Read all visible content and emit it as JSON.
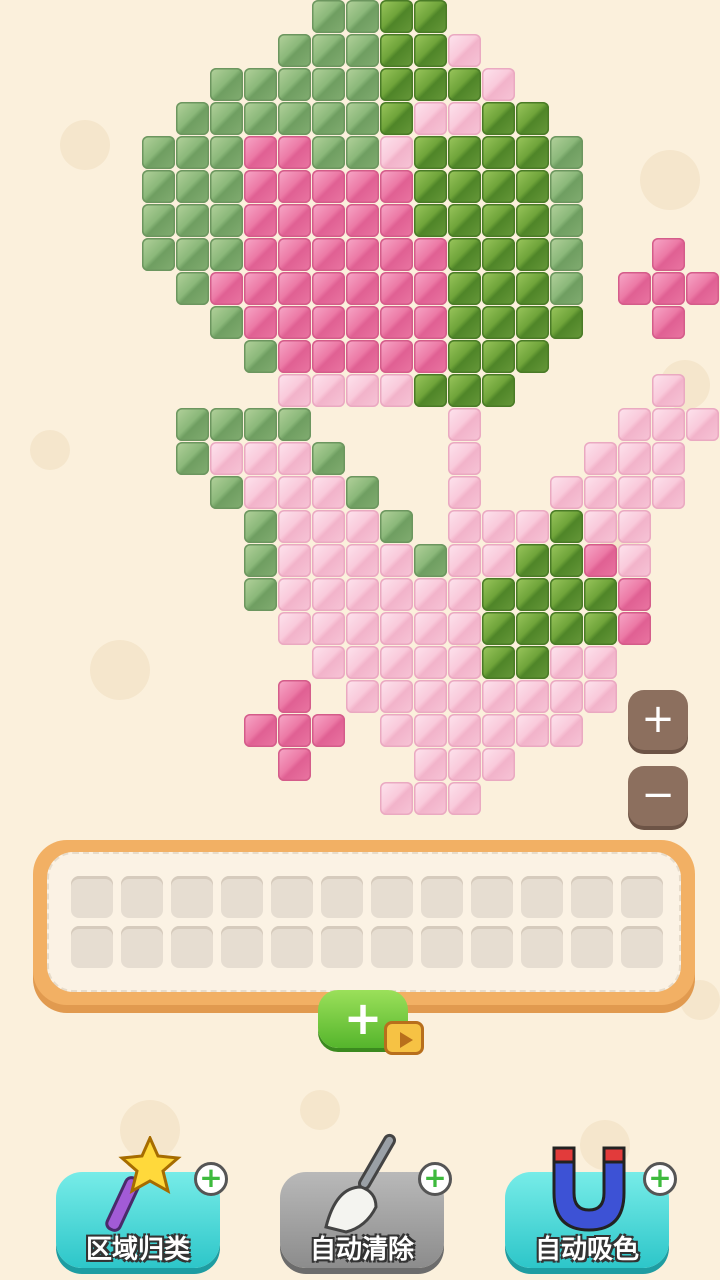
{
  "board": {
    "grid_origin_note": "",
    "blocks": [
      {
        "c": 7,
        "r": 0,
        "t": "g"
      },
      {
        "c": 8,
        "r": 0,
        "t": "g"
      },
      {
        "c": 9,
        "r": 0,
        "t": "d"
      },
      {
        "c": 10,
        "r": 0,
        "t": "d"
      },
      {
        "c": 6,
        "r": 1,
        "t": "g"
      },
      {
        "c": 7,
        "r": 1,
        "t": "g"
      },
      {
        "c": 8,
        "r": 1,
        "t": "g"
      },
      {
        "c": 9,
        "r": 1,
        "t": "d"
      },
      {
        "c": 10,
        "r": 1,
        "t": "d"
      },
      {
        "c": 11,
        "r": 1,
        "t": "l"
      },
      {
        "c": 4,
        "r": 2,
        "t": "g"
      },
      {
        "c": 5,
        "r": 2,
        "t": "g"
      },
      {
        "c": 6,
        "r": 2,
        "t": "g"
      },
      {
        "c": 7,
        "r": 2,
        "t": "g"
      },
      {
        "c": 8,
        "r": 2,
        "t": "g"
      },
      {
        "c": 9,
        "r": 2,
        "t": "d"
      },
      {
        "c": 10,
        "r": 2,
        "t": "d"
      },
      {
        "c": 11,
        "r": 2,
        "t": "d"
      },
      {
        "c": 12,
        "r": 2,
        "t": "l"
      },
      {
        "c": 3,
        "r": 3,
        "t": "g"
      },
      {
        "c": 4,
        "r": 3,
        "t": "g"
      },
      {
        "c": 5,
        "r": 3,
        "t": "g"
      },
      {
        "c": 6,
        "r": 3,
        "t": "g"
      },
      {
        "c": 7,
        "r": 3,
        "t": "g"
      },
      {
        "c": 8,
        "r": 3,
        "t": "g"
      },
      {
        "c": 9,
        "r": 3,
        "t": "d"
      },
      {
        "c": 10,
        "r": 3,
        "t": "l"
      },
      {
        "c": 11,
        "r": 3,
        "t": "l"
      },
      {
        "c": 12,
        "r": 3,
        "t": "d"
      },
      {
        "c": 13,
        "r": 3,
        "t": "d"
      },
      {
        "c": 2,
        "r": 4,
        "t": "g"
      },
      {
        "c": 3,
        "r": 4,
        "t": "g"
      },
      {
        "c": 4,
        "r": 4,
        "t": "g"
      },
      {
        "c": 5,
        "r": 4,
        "t": "p"
      },
      {
        "c": 6,
        "r": 4,
        "t": "p"
      },
      {
        "c": 7,
        "r": 4,
        "t": "g"
      },
      {
        "c": 8,
        "r": 4,
        "t": "g"
      },
      {
        "c": 9,
        "r": 4,
        "t": "l"
      },
      {
        "c": 10,
        "r": 4,
        "t": "d"
      },
      {
        "c": 11,
        "r": 4,
        "t": "d"
      },
      {
        "c": 12,
        "r": 4,
        "t": "d"
      },
      {
        "c": 13,
        "r": 4,
        "t": "d"
      },
      {
        "c": 14,
        "r": 4,
        "t": "g"
      },
      {
        "c": 2,
        "r": 5,
        "t": "g"
      },
      {
        "c": 3,
        "r": 5,
        "t": "g"
      },
      {
        "c": 4,
        "r": 5,
        "t": "g"
      },
      {
        "c": 5,
        "r": 5,
        "t": "p"
      },
      {
        "c": 6,
        "r": 5,
        "t": "p"
      },
      {
        "c": 7,
        "r": 5,
        "t": "p"
      },
      {
        "c": 8,
        "r": 5,
        "t": "p"
      },
      {
        "c": 9,
        "r": 5,
        "t": "p"
      },
      {
        "c": 10,
        "r": 5,
        "t": "d"
      },
      {
        "c": 11,
        "r": 5,
        "t": "d"
      },
      {
        "c": 12,
        "r": 5,
        "t": "d"
      },
      {
        "c": 13,
        "r": 5,
        "t": "d"
      },
      {
        "c": 14,
        "r": 5,
        "t": "g"
      },
      {
        "c": 2,
        "r": 6,
        "t": "g"
      },
      {
        "c": 3,
        "r": 6,
        "t": "g"
      },
      {
        "c": 4,
        "r": 6,
        "t": "g"
      },
      {
        "c": 5,
        "r": 6,
        "t": "p"
      },
      {
        "c": 6,
        "r": 6,
        "t": "p"
      },
      {
        "c": 7,
        "r": 6,
        "t": "p"
      },
      {
        "c": 8,
        "r": 6,
        "t": "p"
      },
      {
        "c": 9,
        "r": 6,
        "t": "p"
      },
      {
        "c": 10,
        "r": 6,
        "t": "d"
      },
      {
        "c": 11,
        "r": 6,
        "t": "d"
      },
      {
        "c": 12,
        "r": 6,
        "t": "d"
      },
      {
        "c": 13,
        "r": 6,
        "t": "d"
      },
      {
        "c": 14,
        "r": 6,
        "t": "g"
      },
      {
        "c": 2,
        "r": 7,
        "t": "g"
      },
      {
        "c": 3,
        "r": 7,
        "t": "g"
      },
      {
        "c": 4,
        "r": 7,
        "t": "g"
      },
      {
        "c": 5,
        "r": 7,
        "t": "p"
      },
      {
        "c": 6,
        "r": 7,
        "t": "p"
      },
      {
        "c": 7,
        "r": 7,
        "t": "p"
      },
      {
        "c": 8,
        "r": 7,
        "t": "p"
      },
      {
        "c": 9,
        "r": 7,
        "t": "p"
      },
      {
        "c": 10,
        "r": 7,
        "t": "p"
      },
      {
        "c": 11,
        "r": 7,
        "t": "d"
      },
      {
        "c": 12,
        "r": 7,
        "t": "d"
      },
      {
        "c": 13,
        "r": 7,
        "t": "d"
      },
      {
        "c": 14,
        "r": 7,
        "t": "g"
      },
      {
        "c": 3,
        "r": 8,
        "t": "g"
      },
      {
        "c": 4,
        "r": 8,
        "t": "p"
      },
      {
        "c": 5,
        "r": 8,
        "t": "p"
      },
      {
        "c": 6,
        "r": 8,
        "t": "p"
      },
      {
        "c": 7,
        "r": 8,
        "t": "p"
      },
      {
        "c": 8,
        "r": 8,
        "t": "p"
      },
      {
        "c": 9,
        "r": 8,
        "t": "p"
      },
      {
        "c": 10,
        "r": 8,
        "t": "p"
      },
      {
        "c": 11,
        "r": 8,
        "t": "d"
      },
      {
        "c": 12,
        "r": 8,
        "t": "d"
      },
      {
        "c": 13,
        "r": 8,
        "t": "d"
      },
      {
        "c": 14,
        "r": 8,
        "t": "g"
      },
      {
        "c": 4,
        "r": 9,
        "t": "g"
      },
      {
        "c": 5,
        "r": 9,
        "t": "p"
      },
      {
        "c": 6,
        "r": 9,
        "t": "p"
      },
      {
        "c": 7,
        "r": 9,
        "t": "p"
      },
      {
        "c": 8,
        "r": 9,
        "t": "p"
      },
      {
        "c": 9,
        "r": 9,
        "t": "p"
      },
      {
        "c": 10,
        "r": 9,
        "t": "p"
      },
      {
        "c": 11,
        "r": 9,
        "t": "d"
      },
      {
        "c": 12,
        "r": 9,
        "t": "d"
      },
      {
        "c": 13,
        "r": 9,
        "t": "d"
      },
      {
        "c": 14,
        "r": 9,
        "t": "d"
      },
      {
        "c": 5,
        "r": 10,
        "t": "g"
      },
      {
        "c": 6,
        "r": 10,
        "t": "p"
      },
      {
        "c": 7,
        "r": 10,
        "t": "p"
      },
      {
        "c": 8,
        "r": 10,
        "t": "p"
      },
      {
        "c": 9,
        "r": 10,
        "t": "p"
      },
      {
        "c": 10,
        "r": 10,
        "t": "p"
      },
      {
        "c": 11,
        "r": 10,
        "t": "d"
      },
      {
        "c": 12,
        "r": 10,
        "t": "d"
      },
      {
        "c": 13,
        "r": 10,
        "t": "d"
      },
      {
        "c": 6,
        "r": 11,
        "t": "l"
      },
      {
        "c": 7,
        "r": 11,
        "t": "l"
      },
      {
        "c": 8,
        "r": 11,
        "t": "l"
      },
      {
        "c": 9,
        "r": 11,
        "t": "l"
      },
      {
        "c": 10,
        "r": 11,
        "t": "d"
      },
      {
        "c": 11,
        "r": 11,
        "t": "d"
      },
      {
        "c": 12,
        "r": 11,
        "t": "d"
      },
      {
        "c": 17,
        "r": 7,
        "t": "p"
      },
      {
        "c": 16,
        "r": 8,
        "t": "p"
      },
      {
        "c": 17,
        "r": 8,
        "t": "p"
      },
      {
        "c": 18,
        "r": 8,
        "t": "p"
      },
      {
        "c": 17,
        "r": 9,
        "t": "p"
      },
      {
        "c": 17,
        "r": 11,
        "t": "l"
      },
      {
        "c": 3,
        "r": 12,
        "t": "g"
      },
      {
        "c": 4,
        "r": 12,
        "t": "g"
      },
      {
        "c": 5,
        "r": 12,
        "t": "g"
      },
      {
        "c": 6,
        "r": 12,
        "t": "g"
      },
      {
        "c": 11,
        "r": 12,
        "t": "l"
      },
      {
        "c": 16,
        "r": 12,
        "t": "l"
      },
      {
        "c": 17,
        "r": 12,
        "t": "l"
      },
      {
        "c": 18,
        "r": 12,
        "t": "l"
      },
      {
        "c": 3,
        "r": 13,
        "t": "g"
      },
      {
        "c": 4,
        "r": 13,
        "t": "l"
      },
      {
        "c": 5,
        "r": 13,
        "t": "l"
      },
      {
        "c": 6,
        "r": 13,
        "t": "l"
      },
      {
        "c": 7,
        "r": 13,
        "t": "g"
      },
      {
        "c": 11,
        "r": 13,
        "t": "l"
      },
      {
        "c": 15,
        "r": 13,
        "t": "l"
      },
      {
        "c": 16,
        "r": 13,
        "t": "l"
      },
      {
        "c": 17,
        "r": 13,
        "t": "l"
      },
      {
        "c": 4,
        "r": 14,
        "t": "g"
      },
      {
        "c": 5,
        "r": 14,
        "t": "l"
      },
      {
        "c": 6,
        "r": 14,
        "t": "l"
      },
      {
        "c": 7,
        "r": 14,
        "t": "l"
      },
      {
        "c": 8,
        "r": 14,
        "t": "g"
      },
      {
        "c": 11,
        "r": 14,
        "t": "l"
      },
      {
        "c": 14,
        "r": 14,
        "t": "l"
      },
      {
        "c": 15,
        "r": 14,
        "t": "l"
      },
      {
        "c": 16,
        "r": 14,
        "t": "l"
      },
      {
        "c": 17,
        "r": 14,
        "t": "l"
      },
      {
        "c": 5,
        "r": 15,
        "t": "g"
      },
      {
        "c": 6,
        "r": 15,
        "t": "l"
      },
      {
        "c": 7,
        "r": 15,
        "t": "l"
      },
      {
        "c": 8,
        "r": 15,
        "t": "l"
      },
      {
        "c": 9,
        "r": 15,
        "t": "g"
      },
      {
        "c": 11,
        "r": 15,
        "t": "l"
      },
      {
        "c": 12,
        "r": 15,
        "t": "l"
      },
      {
        "c": 13,
        "r": 15,
        "t": "l"
      },
      {
        "c": 14,
        "r": 15,
        "t": "d"
      },
      {
        "c": 15,
        "r": 15,
        "t": "l"
      },
      {
        "c": 16,
        "r": 15,
        "t": "l"
      },
      {
        "c": 5,
        "r": 16,
        "t": "g"
      },
      {
        "c": 6,
        "r": 16,
        "t": "l"
      },
      {
        "c": 7,
        "r": 16,
        "t": "l"
      },
      {
        "c": 8,
        "r": 16,
        "t": "l"
      },
      {
        "c": 9,
        "r": 16,
        "t": "l"
      },
      {
        "c": 10,
        "r": 16,
        "t": "g"
      },
      {
        "c": 11,
        "r": 16,
        "t": "l"
      },
      {
        "c": 12,
        "r": 16,
        "t": "l"
      },
      {
        "c": 13,
        "r": 16,
        "t": "d"
      },
      {
        "c": 14,
        "r": 16,
        "t": "d"
      },
      {
        "c": 15,
        "r": 16,
        "t": "p"
      },
      {
        "c": 16,
        "r": 16,
        "t": "l"
      },
      {
        "c": 5,
        "r": 17,
        "t": "g"
      },
      {
        "c": 6,
        "r": 17,
        "t": "l"
      },
      {
        "c": 7,
        "r": 17,
        "t": "l"
      },
      {
        "c": 8,
        "r": 17,
        "t": "l"
      },
      {
        "c": 9,
        "r": 17,
        "t": "l"
      },
      {
        "c": 10,
        "r": 17,
        "t": "l"
      },
      {
        "c": 11,
        "r": 17,
        "t": "l"
      },
      {
        "c": 12,
        "r": 17,
        "t": "d"
      },
      {
        "c": 13,
        "r": 17,
        "t": "d"
      },
      {
        "c": 14,
        "r": 17,
        "t": "d"
      },
      {
        "c": 15,
        "r": 17,
        "t": "d"
      },
      {
        "c": 16,
        "r": 17,
        "t": "p"
      },
      {
        "c": 6,
        "r": 18,
        "t": "l"
      },
      {
        "c": 7,
        "r": 18,
        "t": "l"
      },
      {
        "c": 8,
        "r": 18,
        "t": "l"
      },
      {
        "c": 9,
        "r": 18,
        "t": "l"
      },
      {
        "c": 10,
        "r": 18,
        "t": "l"
      },
      {
        "c": 11,
        "r": 18,
        "t": "l"
      },
      {
        "c": 12,
        "r": 18,
        "t": "d"
      },
      {
        "c": 13,
        "r": 18,
        "t": "d"
      },
      {
        "c": 14,
        "r": 18,
        "t": "d"
      },
      {
        "c": 15,
        "r": 18,
        "t": "d"
      },
      {
        "c": 16,
        "r": 18,
        "t": "p"
      },
      {
        "c": 7,
        "r": 19,
        "t": "l"
      },
      {
        "c": 8,
        "r": 19,
        "t": "l"
      },
      {
        "c": 9,
        "r": 19,
        "t": "l"
      },
      {
        "c": 10,
        "r": 19,
        "t": "l"
      },
      {
        "c": 11,
        "r": 19,
        "t": "l"
      },
      {
        "c": 12,
        "r": 19,
        "t": "d"
      },
      {
        "c": 13,
        "r": 19,
        "t": "d"
      },
      {
        "c": 14,
        "r": 19,
        "t": "l"
      },
      {
        "c": 15,
        "r": 19,
        "t": "l"
      },
      {
        "c": 8,
        "r": 20,
        "t": "l"
      },
      {
        "c": 9,
        "r": 20,
        "t": "l"
      },
      {
        "c": 10,
        "r": 20,
        "t": "l"
      },
      {
        "c": 11,
        "r": 20,
        "t": "l"
      },
      {
        "c": 12,
        "r": 20,
        "t": "l"
      },
      {
        "c": 13,
        "r": 20,
        "t": "l"
      },
      {
        "c": 14,
        "r": 20,
        "t": "l"
      },
      {
        "c": 15,
        "r": 20,
        "t": "l"
      },
      {
        "c": 6,
        "r": 20,
        "t": "p"
      },
      {
        "c": 5,
        "r": 21,
        "t": "p"
      },
      {
        "c": 6,
        "r": 21,
        "t": "p"
      },
      {
        "c": 7,
        "r": 21,
        "t": "p"
      },
      {
        "c": 6,
        "r": 22,
        "t": "p"
      },
      {
        "c": 9,
        "r": 21,
        "t": "l"
      },
      {
        "c": 10,
        "r": 21,
        "t": "l"
      },
      {
        "c": 11,
        "r": 21,
        "t": "l"
      },
      {
        "c": 12,
        "r": 21,
        "t": "l"
      },
      {
        "c": 13,
        "r": 21,
        "t": "l"
      },
      {
        "c": 14,
        "r": 21,
        "t": "l"
      },
      {
        "c": 10,
        "r": 22,
        "t": "l"
      },
      {
        "c": 11,
        "r": 22,
        "t": "l"
      },
      {
        "c": 12,
        "r": 22,
        "t": "l"
      },
      {
        "c": 9,
        "r": 23,
        "t": "l"
      },
      {
        "c": 10,
        "r": 23,
        "t": "l"
      },
      {
        "c": 11,
        "r": 23,
        "t": "l"
      }
    ]
  },
  "zoom": {
    "in_symbol": "+",
    "out_symbol": "−"
  },
  "tray": {
    "rows": 2,
    "slots_per_row": 12
  },
  "add_slot": {
    "symbol": "+",
    "icon": "video-ad-icon"
  },
  "tools": [
    {
      "label": "区域归类",
      "icon": "magic-wand-icon"
    },
    {
      "label": "自动清除",
      "icon": "broom-icon"
    },
    {
      "label": "自动吸色",
      "icon": "magnet-icon"
    }
  ],
  "colors": {
    "light_green": "#8bb87a",
    "dark_green": "#6fa43a",
    "pink": "#ec7aa6",
    "light_pink": "#f9cadb",
    "background": "#fbf0dc"
  }
}
